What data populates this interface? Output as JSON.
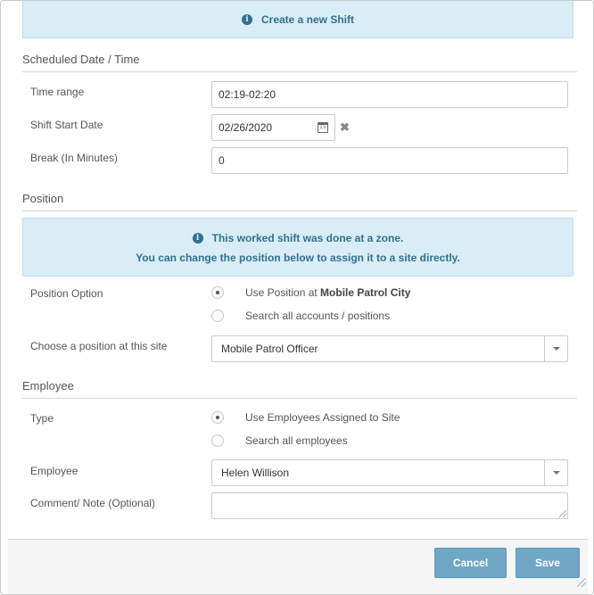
{
  "header": {
    "icon": "info-icon",
    "title": "Create a new Shift"
  },
  "sections": {
    "scheduled": "Scheduled Date / Time",
    "position": "Position",
    "employee": "Employee"
  },
  "scheduled": {
    "time_range_label": "Time range",
    "time_range_value": "02:19-02:20",
    "start_date_label": "Shift Start Date",
    "start_date_value": "02/26/2020",
    "clear_symbol": "✖",
    "break_label": "Break (In Minutes)",
    "break_value": "0"
  },
  "position": {
    "info_line1": "This worked shift was done at a zone.",
    "info_line2": "You can change the position below to assign it to a site directly.",
    "option_label": "Position Option",
    "option_use_prefix": "Use Position at ",
    "option_use_site": "Mobile Patrol City",
    "option_search": "Search all accounts / positions",
    "selected_option": "use",
    "choose_label": "Choose a position at this site",
    "choose_value": "Mobile Patrol Officer"
  },
  "employee": {
    "type_label": "Type",
    "type_assigned": "Use Employees Assigned to Site",
    "type_search": "Search all employees",
    "selected_type": "assigned",
    "employee_label": "Employee",
    "employee_value": "Helen Willison",
    "comment_label": "Comment/ Note (Optional)",
    "comment_value": ""
  },
  "footer": {
    "cancel_label": "Cancel",
    "save_label": "Save"
  },
  "colors": {
    "info_bg": "#d9edf7",
    "info_text": "#31708f",
    "button": "#6fa7c4"
  }
}
